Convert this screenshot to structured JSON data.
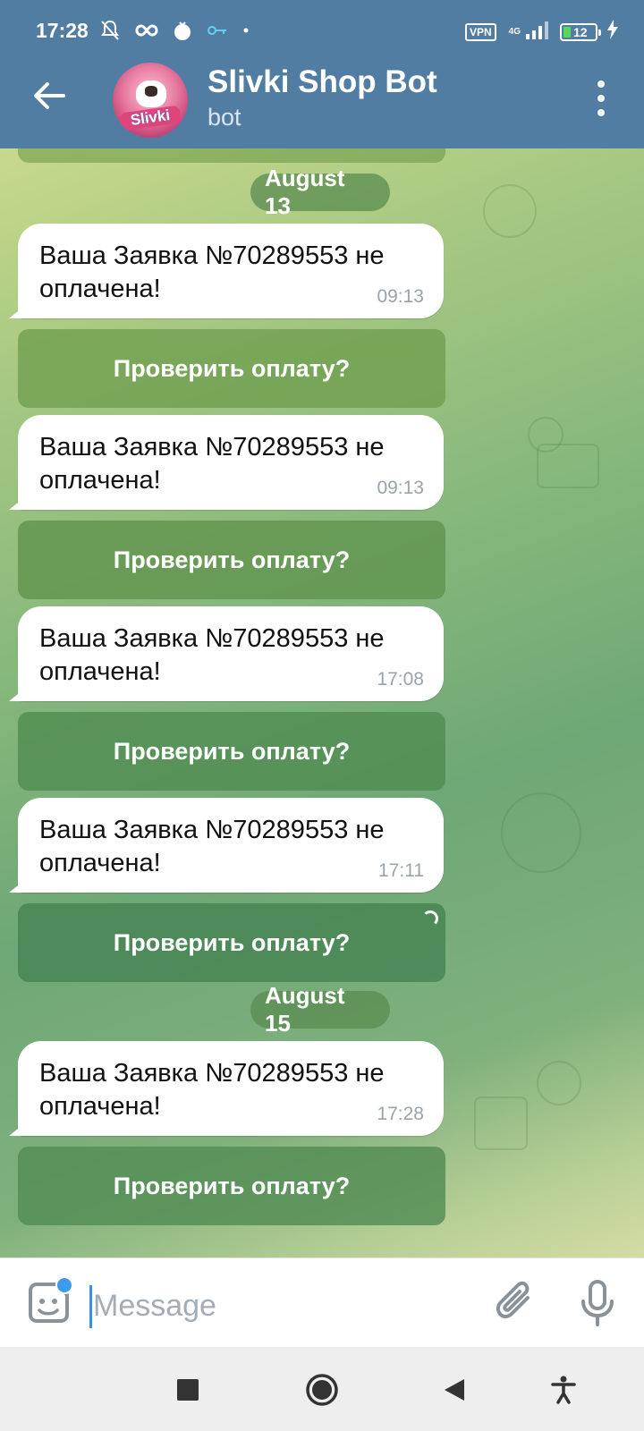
{
  "status_bar": {
    "time": "17:28",
    "vpn": "VPN",
    "network": "4G",
    "battery": "12"
  },
  "header": {
    "title": "Slivki Shop Bot",
    "subtitle": "bot",
    "avatar_text": "Slivki"
  },
  "chat": {
    "date_1": "August 13",
    "date_2": "August 15",
    "messages": [
      {
        "text": "Ваша Заявка №70289553 не оплачена!",
        "time": "09:13",
        "button": "Проверить оплату?"
      },
      {
        "text": "Ваша Заявка №70289553 не оплачена!",
        "time": "09:13",
        "button": "Проверить оплату?"
      },
      {
        "text": "Ваша Заявка №70289553 не оплачена!",
        "time": "17:08",
        "button": "Проверить оплату?"
      },
      {
        "text": "Ваша Заявка №70289553 не оплачена!",
        "time": "17:11",
        "button": "Проверить оплату?"
      },
      {
        "text": "Ваша Заявка №70289553 не оплачена!",
        "time": "17:28",
        "button": "Проверить оплату?"
      }
    ]
  },
  "input": {
    "placeholder": "Message",
    "value": ""
  },
  "colors": {
    "header": "#527da3",
    "accent": "#3d9be9"
  }
}
